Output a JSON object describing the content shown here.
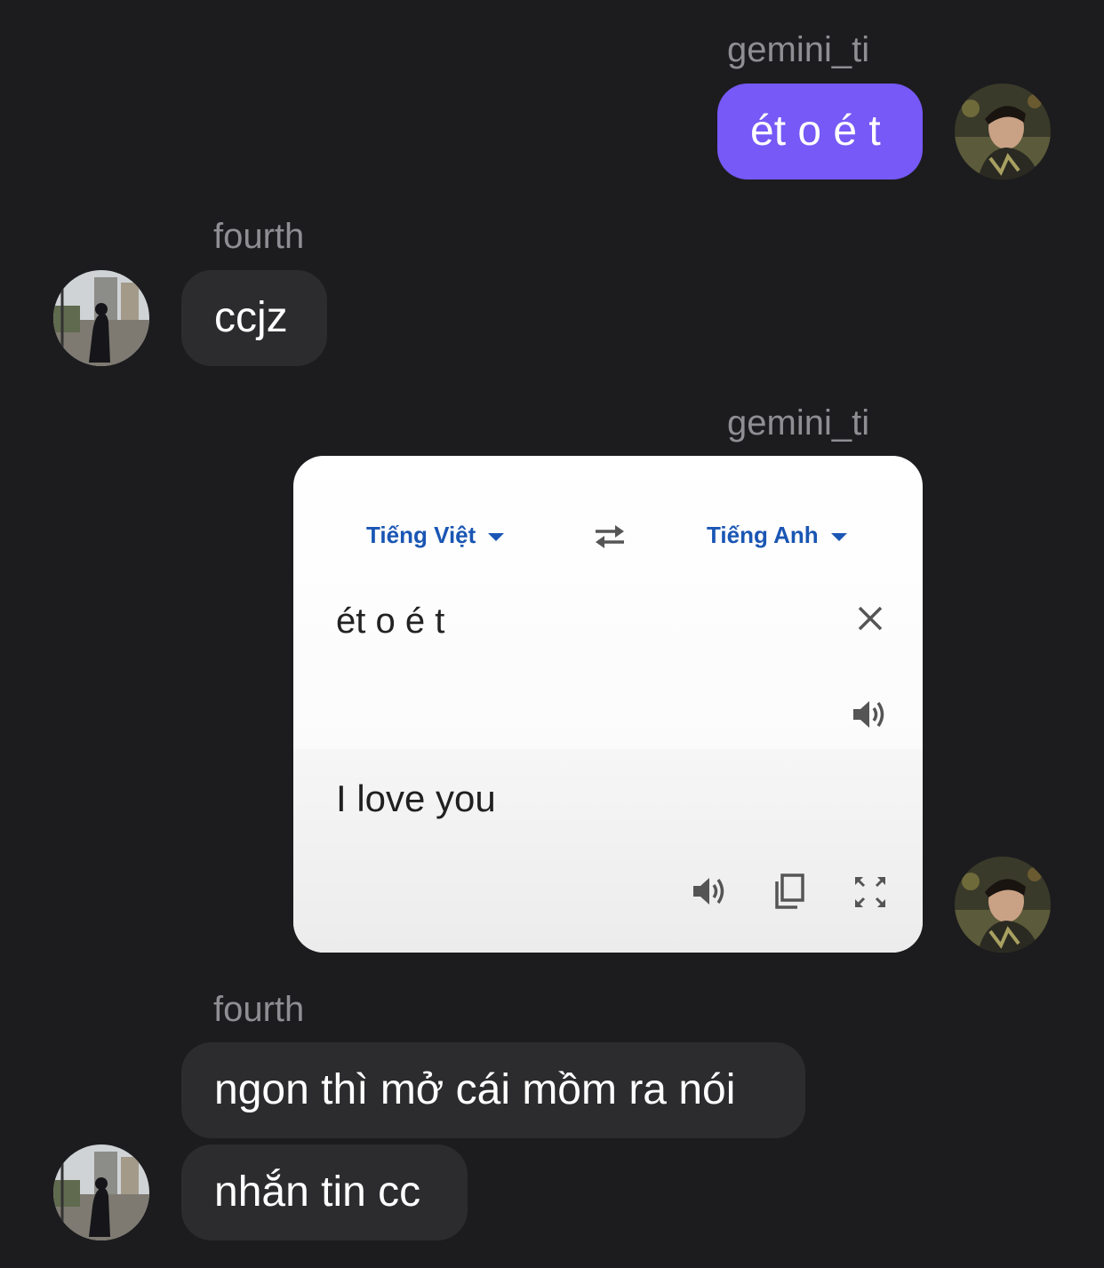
{
  "messages": [
    {
      "sender": "gemini_ti",
      "text": "ét o é t"
    },
    {
      "sender": "fourth",
      "text": "ccjz"
    },
    {
      "sender": "gemini_ti"
    },
    {
      "sender": "fourth",
      "text": "ngon thì mở cái mồm ra nói"
    },
    {
      "text": "nhắn tin cc"
    }
  ],
  "translate": {
    "source_lang": "Tiếng Việt",
    "target_lang": "Tiếng Anh",
    "source_text": "ét o é t",
    "result_text": "I love you"
  },
  "colors": {
    "background": "#1c1c1e",
    "outgoing_bubble": "#7659f6",
    "incoming_bubble": "#2c2c2e",
    "sender_name": "#8e8e93",
    "translate_lang": "#1a56b4"
  }
}
